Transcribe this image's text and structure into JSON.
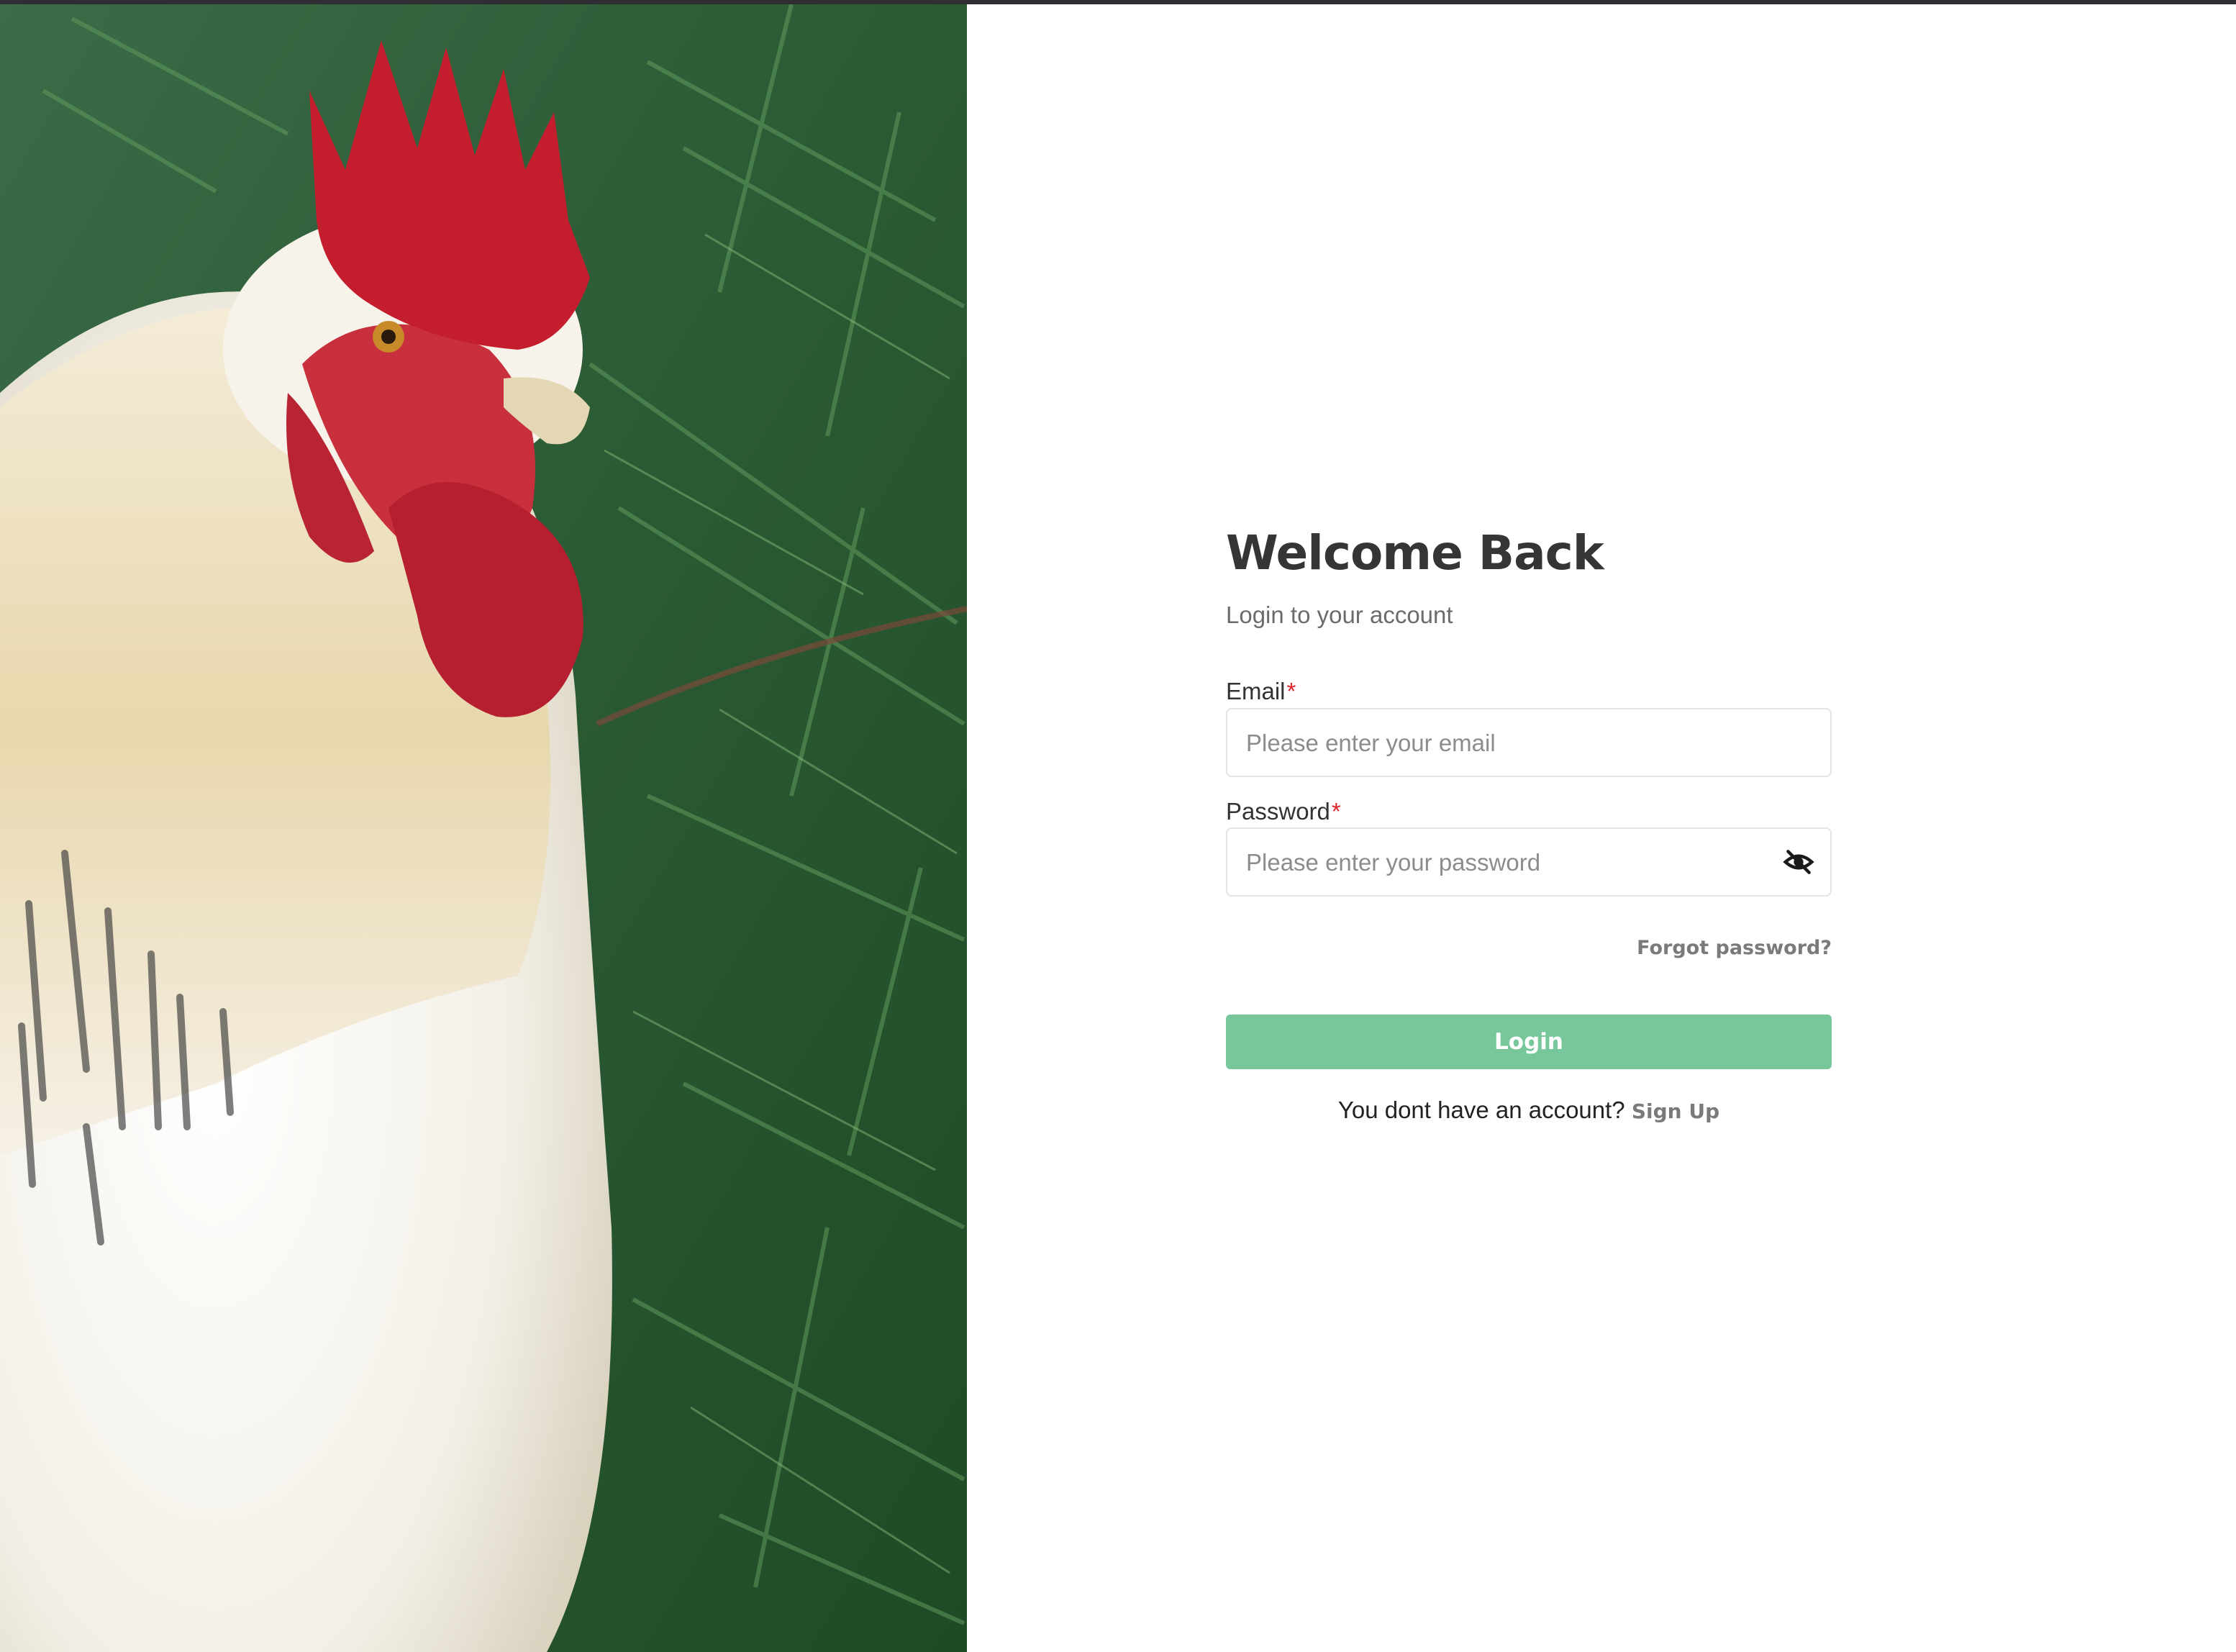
{
  "colors": {
    "accent": "#77c79b",
    "required": "#e0232b",
    "title": "#353535",
    "link": "#7a7a7a"
  },
  "hero": {
    "description_icon": "rooster-photo"
  },
  "login": {
    "title": "Welcome Back",
    "subtitle": "Login to your account",
    "email_label": "Email",
    "email_placeholder": "Please enter your email",
    "password_label": "Password",
    "password_placeholder": "Please enter your password",
    "required_mark": "*",
    "toggle_icon": "eye-slash-icon",
    "forgot_label": "Forgot password?",
    "submit_label": "Login",
    "signup_prompt": "You dont have an account?",
    "signup_label": "Sign Up"
  }
}
